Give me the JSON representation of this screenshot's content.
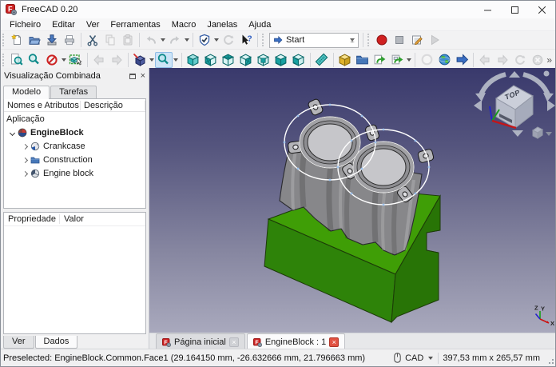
{
  "window": {
    "title": "FreeCAD 0.20"
  },
  "menubar": {
    "items": [
      "Ficheiro",
      "Editar",
      "Ver",
      "Ferramentas",
      "Macro",
      "Janelas",
      "Ajuda"
    ]
  },
  "toolbars": {
    "workbench_selected": "Start",
    "overflow": "»",
    "row1_icons": [
      "new-file",
      "open-file",
      "save",
      "print",
      "cut",
      "copy",
      "paste",
      "undo",
      "redo",
      "validate",
      "refresh",
      "whats-this",
      "macro-record",
      "macro-stop",
      "macro-edit",
      "macro-play"
    ],
    "row2_icons": [
      "fit-all",
      "fit-selection",
      "draw-style",
      "box-selection",
      "nav-back",
      "nav-forward",
      "view-isometric",
      "zoom",
      "view-axonometric",
      "view-front",
      "view-top",
      "view-right",
      "view-rear",
      "view-bottom",
      "view-left",
      "measure",
      "create-part",
      "create-group",
      "make-link",
      "make-sub-link",
      "web-stop",
      "web-browser",
      "web-open",
      "browser-back",
      "browser-forward",
      "browser-refresh",
      "browser-stop"
    ]
  },
  "combined_view": {
    "title": "Visualização Combinada",
    "tabs": {
      "model": "Modelo",
      "tasks": "Tarefas"
    },
    "tree": {
      "columns": [
        "Nomes e Atributos",
        "Descrição"
      ],
      "root_label": "Aplicação",
      "document_label": "EngineBlock",
      "children": [
        {
          "label": "Crankcase"
        },
        {
          "label": "Construction"
        },
        {
          "label": "Engine block"
        }
      ]
    },
    "properties": {
      "columns": [
        "Propriedade",
        "Valor"
      ]
    },
    "bottom_tabs": {
      "view": "Ver",
      "data": "Dados"
    }
  },
  "mdi_tabs": {
    "home": "Página inicial",
    "document": "EngineBlock : 1"
  },
  "viewport": {
    "nav_cube_top": "TOP",
    "axis_x": "X",
    "axis_y": "Y",
    "axis_z": "Z"
  },
  "statusbar": {
    "message": "Preselected: EngineBlock.Common.Face1 (29.164150 mm, -26.632666 mm, 21.796663 mm)",
    "nav_style": "CAD",
    "viewport_size": "397,53 mm x 265,57 mm"
  },
  "colors": {
    "viewport_gradient_top": "#39396c",
    "viewport_gradient_bottom": "#a9a9bd",
    "crankcase_green": "#3f9e06",
    "engine_block_gray": "#8b8b8d",
    "preselect_highlight": "#ffffff",
    "record_red": "#cf2020",
    "view_icon_teal": "#18a7a7"
  }
}
